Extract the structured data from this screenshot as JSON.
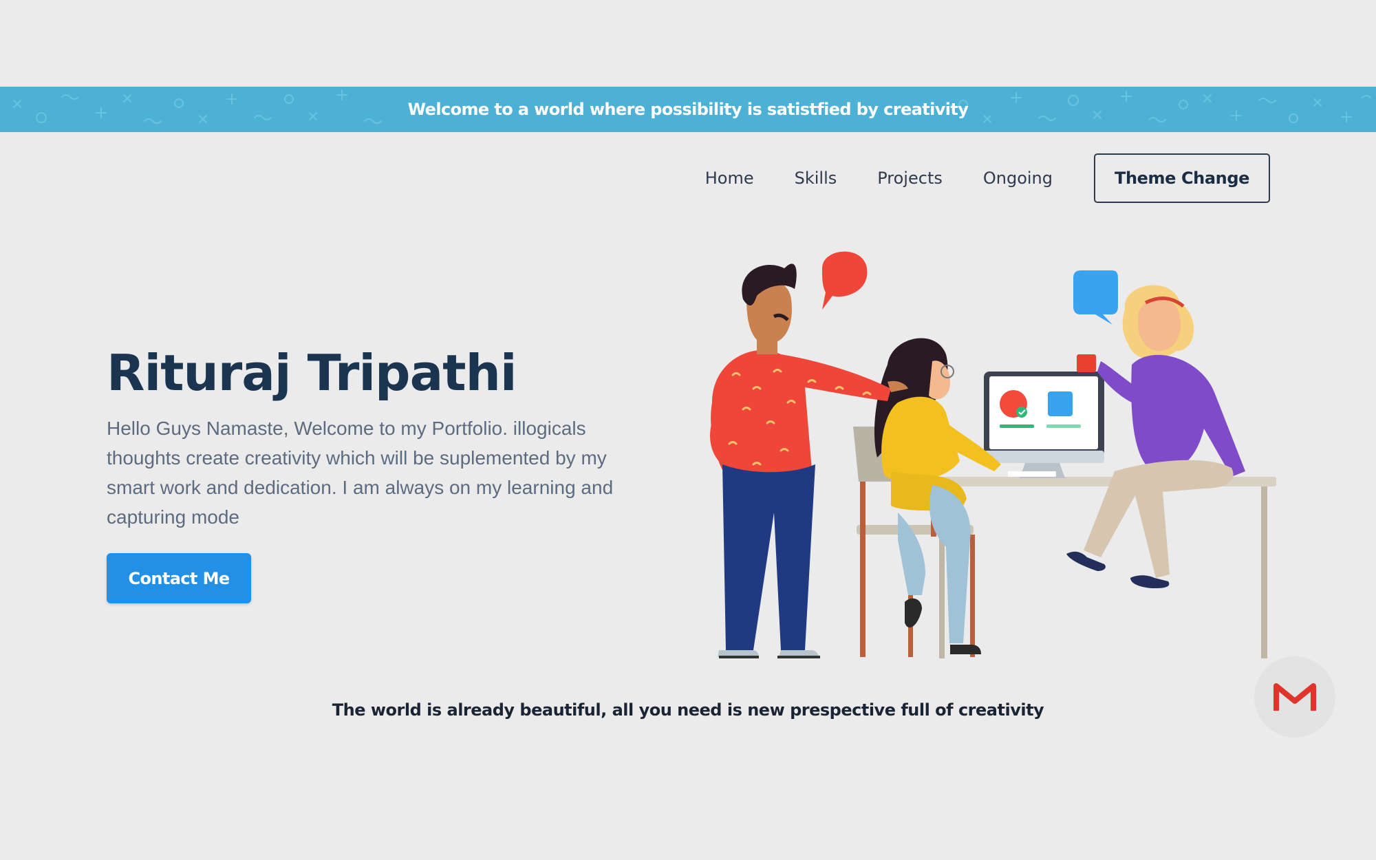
{
  "banner": {
    "text": "Welcome to a world where possibility is satistfied by creativity",
    "bg_color": "#4db1d6"
  },
  "nav": {
    "items": [
      {
        "label": "Home"
      },
      {
        "label": "Skills"
      },
      {
        "label": "Projects"
      },
      {
        "label": "Ongoing"
      }
    ],
    "theme_button_label": "Theme Change"
  },
  "hero": {
    "title": "Rituraj Tripathi",
    "description": "Hello Guys Namaste, Welcome to my Portfolio. illogicals thoughts create creativity which will be suplemented by my smart work and dedication. I am always on my learning and capturing mode",
    "contact_button_label": "Contact Me",
    "accent_color": "#2390e8",
    "illustration_icon": "team-working-illustration"
  },
  "tagline": {
    "text": "The world is already beautiful, all you need is new prespective full of creativity"
  },
  "floating": {
    "icon": "gmail-icon"
  },
  "colors": {
    "background": "#ebebeb",
    "title": "#1b3551",
    "body_text": "#5d6b80"
  }
}
